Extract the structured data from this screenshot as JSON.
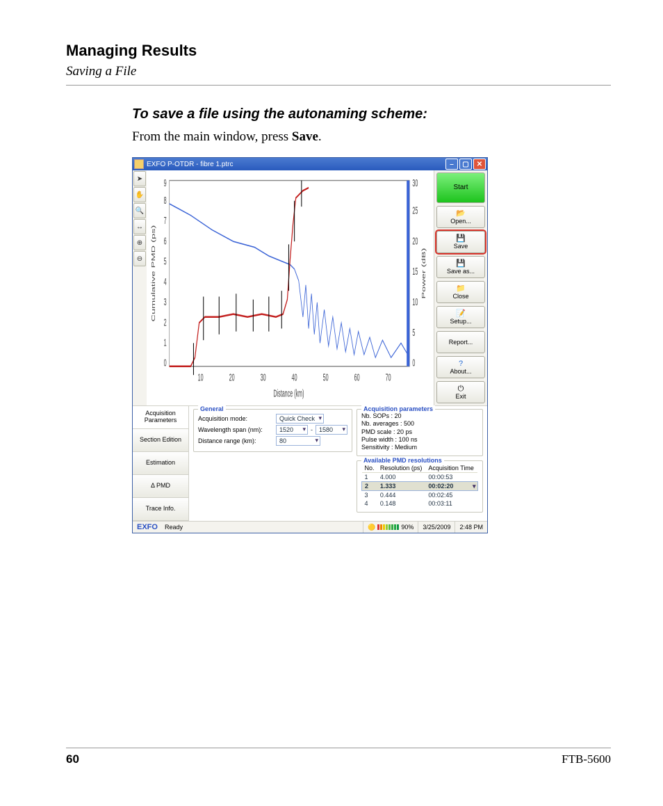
{
  "header": {
    "title": "Managing Results",
    "subtitle": "Saving a File"
  },
  "section": {
    "heading": "To save a file using the autonaming scheme:",
    "instruction_prefix": "From the main window, press ",
    "instruction_bold": "Save",
    "instruction_suffix": "."
  },
  "app": {
    "title": "EXFO P-OTDR - fibre 1.ptrc",
    "buttons": {
      "start": "Start",
      "open": "Open...",
      "save": "Save",
      "save_as": "Save as...",
      "close": "Close",
      "setup": "Setup...",
      "report": "Report...",
      "about": "About...",
      "exit": "Exit"
    },
    "tabs": [
      "Acquisition Parameters",
      "Section Edition",
      "Estimation",
      "Δ PMD",
      "Trace Info."
    ],
    "general": {
      "legend": "General",
      "acq_mode_label": "Acquisition mode:",
      "acq_mode_value": "Quick Check",
      "wavelength_label": "Wavelength span (nm):",
      "wavelength_from": "1520",
      "wavelength_to": "1580",
      "distance_label": "Distance range (km):",
      "distance_value": "80"
    },
    "acq": {
      "legend": "Acquisition parameters",
      "sops": "Nb. SOPs : 20",
      "avg": "Nb. averages : 500",
      "pmd_scale": "PMD scale : 20 ps",
      "pulse": "Pulse width : 100 ns",
      "sens": "Sensitivity : Medium"
    },
    "res": {
      "legend": "Available PMD resolutions",
      "cols": [
        "No.",
        "Resolution (ps)",
        "Acquisition Time"
      ],
      "rows": [
        {
          "no": "1",
          "res": "4.000",
          "time": "00:00:53"
        },
        {
          "no": "2",
          "res": "1.333",
          "time": "00:02:20"
        },
        {
          "no": "3",
          "res": "0.444",
          "time": "00:02:45"
        },
        {
          "no": "4",
          "res": "0.148",
          "time": "00:03:11"
        }
      ]
    },
    "status": {
      "brand": "EXFO",
      "state": "Ready",
      "battery": "90%",
      "date": "3/25/2009",
      "time": "2:48 PM"
    }
  },
  "chart_data": {
    "type": "line",
    "xlabel": "Distance (km)",
    "ylabel_left": "Cumulative PMD (ps)",
    "ylabel_right": "Power (dB)",
    "xlim": [
      0,
      80
    ],
    "ylim_left": [
      0,
      9
    ],
    "ylim_right": [
      0,
      30
    ],
    "x_ticks": [
      10,
      20,
      30,
      40,
      50,
      60,
      70
    ],
    "y_left_ticks": [
      0,
      1,
      2,
      3,
      4,
      5,
      6,
      7,
      8,
      9
    ],
    "y_right_ticks": [
      0,
      5,
      10,
      15,
      20,
      25,
      30
    ],
    "series": [
      {
        "name": "Cumulative PMD",
        "axis": "left",
        "color": "#c3201f",
        "x": [
          0,
          7,
          8,
          10,
          15,
          20,
          25,
          30,
          35,
          37,
          38,
          39,
          40,
          41,
          42,
          43,
          44
        ],
        "values": [
          0,
          0,
          2,
          2.4,
          2.4,
          2.5,
          2.4,
          2.5,
          2.4,
          3.2,
          5.2,
          7.0,
          8.2,
          8.5,
          8.7,
          8.8,
          8.9
        ]
      },
      {
        "name": "Power",
        "axis": "right",
        "color": "#3a63d6",
        "x": [
          0,
          7,
          13,
          20,
          27,
          33,
          37,
          39,
          40,
          41,
          42,
          43,
          44,
          46,
          48,
          50,
          52,
          54,
          56,
          59,
          62,
          66,
          70,
          74,
          78
        ],
        "values": [
          26,
          24.5,
          22.5,
          20.5,
          19,
          18,
          17,
          16,
          14,
          8,
          15,
          6,
          12,
          3,
          11,
          2,
          10,
          2,
          9,
          1,
          8,
          1,
          7,
          1,
          6
        ]
      }
    ],
    "error_bars_axis": "left",
    "error_bars": [
      {
        "x": 8,
        "low": 0,
        "high": 1.2
      },
      {
        "x": 11,
        "low": 1.3,
        "high": 3.5
      },
      {
        "x": 16,
        "low": 1.6,
        "high": 3.5
      },
      {
        "x": 21,
        "low": 1.7,
        "high": 3.6
      },
      {
        "x": 27,
        "low": 1.7,
        "high": 3.3
      },
      {
        "x": 32,
        "low": 1.7,
        "high": 3.5
      },
      {
        "x": 36,
        "low": 1.8,
        "high": 3.7
      },
      {
        "x": 38,
        "low": 3.7,
        "high": 5.9
      },
      {
        "x": 40,
        "low": 6.2,
        "high": 8.2
      },
      {
        "x": 42,
        "low": 8.0,
        "high": 9.0
      }
    ]
  },
  "footer": {
    "page": "60",
    "model": "FTB-5600"
  }
}
